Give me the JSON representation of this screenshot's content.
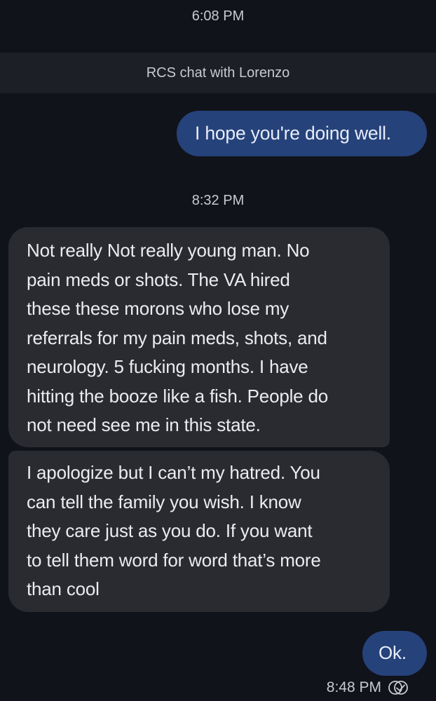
{
  "timestamps": {
    "first": "6:08 PM",
    "second": "8:32 PM"
  },
  "banner": {
    "text": "RCS chat with Lorenzo"
  },
  "messages": [
    {
      "direction": "outgoing",
      "text": "I hope you're doing well."
    },
    {
      "direction": "incoming",
      "text": "Not really Not really young man.  No\npain meds or shots.  The VA hired\nthese these morons who lose my\nreferrals for my pain meds, shots, and\nneurology.   5 fucking months.   I have\nhitting the booze like a fish.  People do\nnot need see me in this state."
    },
    {
      "direction": "incoming",
      "text": "I apologize but I can’t my hatred.  You\ncan tell the family you wish.  I know\nthey care just as you do.   If you want\nto tell them word for word that’s more\nthan cool"
    },
    {
      "direction": "outgoing",
      "text": "Ok."
    }
  ],
  "status": {
    "time": "8:48 PM",
    "icon": "read-receipt-icon"
  },
  "colors": {
    "background": "#11131a",
    "outgoing_bubble": "#25427a",
    "incoming_bubble": "#2a2b31",
    "banner": "#1d1f26"
  }
}
